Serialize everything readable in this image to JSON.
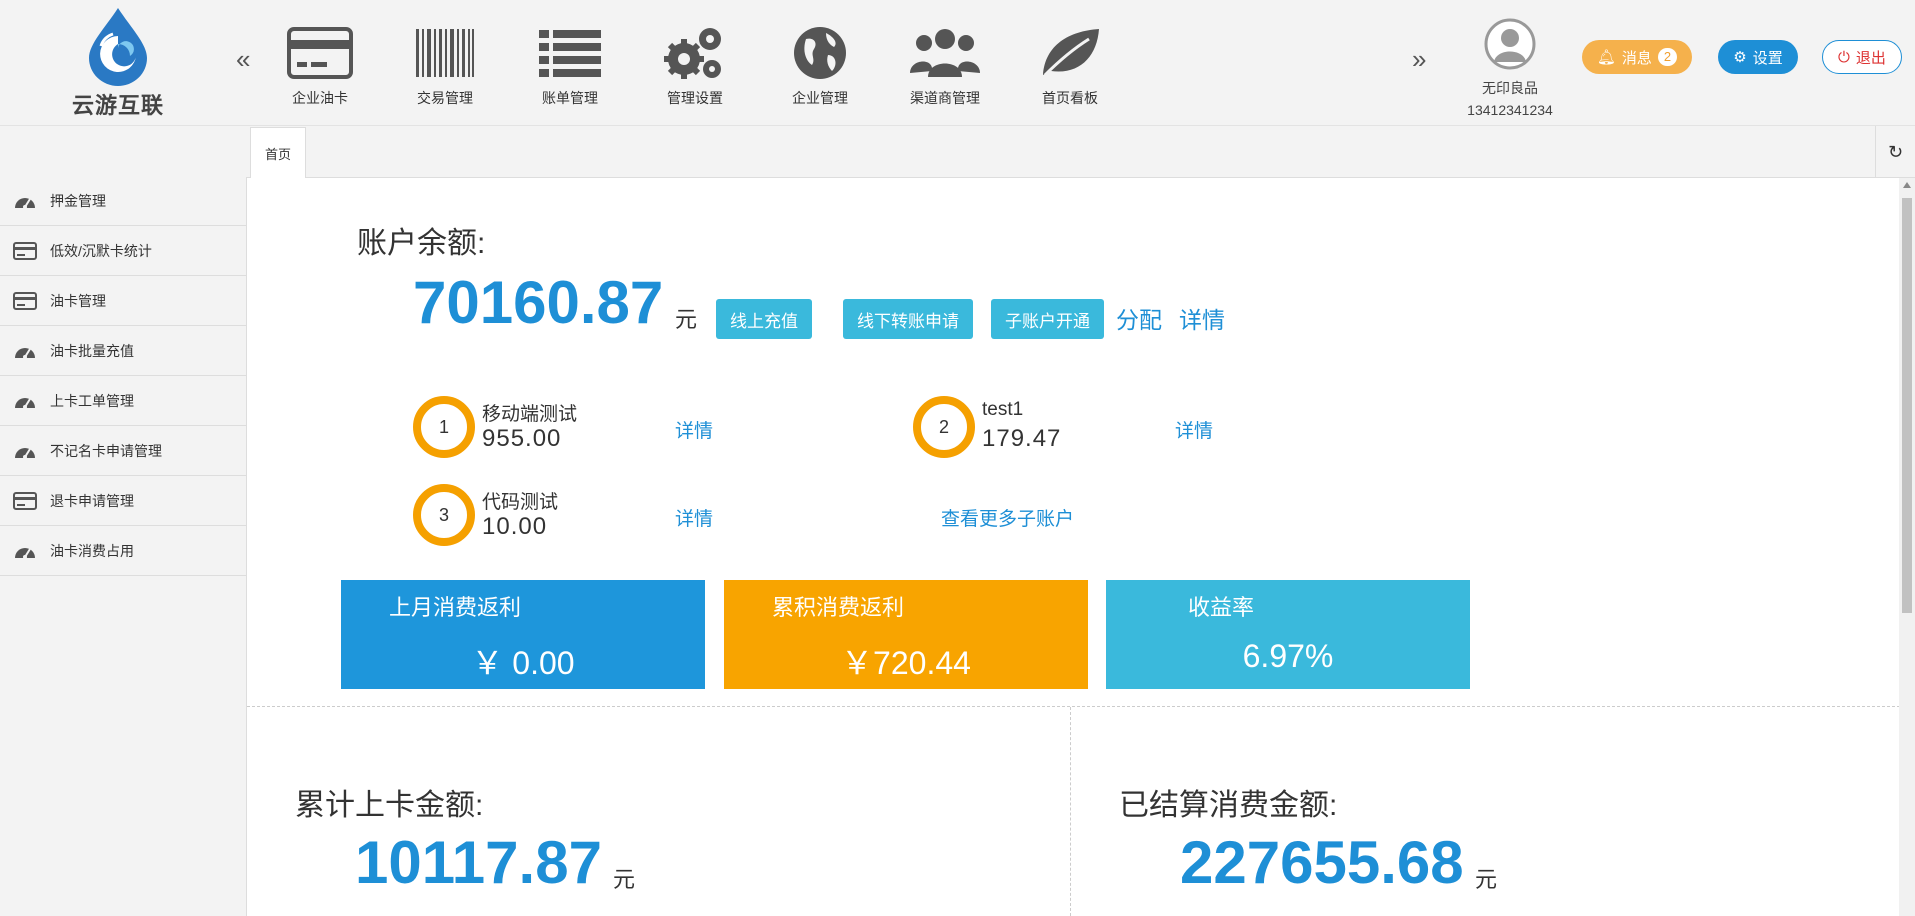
{
  "brand": {
    "name": "云游互联"
  },
  "nav": {
    "prev": "«",
    "next": "»",
    "items": [
      {
        "label": "企业油卡",
        "icon": "card-icon"
      },
      {
        "label": "交易管理",
        "icon": "barcode-icon"
      },
      {
        "label": "账单管理",
        "icon": "list-icon"
      },
      {
        "label": "管理设置",
        "icon": "gears-icon"
      },
      {
        "label": "企业管理",
        "icon": "globe-icon"
      },
      {
        "label": "渠道商管理",
        "icon": "users-icon"
      },
      {
        "label": "首页看板",
        "icon": "leaf-icon"
      }
    ]
  },
  "user": {
    "name": "无印良品",
    "phone": "13412341234"
  },
  "actions": {
    "messages": "消息",
    "messages_count": "2",
    "settings": "设置",
    "logout": "退出"
  },
  "tabs": {
    "home": "首页"
  },
  "sidebar": {
    "items": [
      {
        "label": "押金管理",
        "icon": "dashboard-icon"
      },
      {
        "label": "低效/沉默卡统计",
        "icon": "card-icon"
      },
      {
        "label": "油卡管理",
        "icon": "card-icon"
      },
      {
        "label": "油卡批量充值",
        "icon": "dashboard-icon"
      },
      {
        "label": "上卡工单管理",
        "icon": "dashboard-icon"
      },
      {
        "label": "不记名卡申请管理",
        "icon": "dashboard-icon"
      },
      {
        "label": "退卡申请管理",
        "icon": "card-icon"
      },
      {
        "label": "油卡消费占用",
        "icon": "dashboard-icon"
      }
    ]
  },
  "balance": {
    "label": "账户余额:",
    "amount": "70160.87",
    "unit": "元",
    "buttons": {
      "recharge": "线上充值",
      "transfer": "线下转账申请",
      "open_sub": "子账户开通"
    },
    "links": {
      "allocate": "分配",
      "details": "详情"
    }
  },
  "subaccounts": [
    {
      "rank": "1",
      "name": "移动端测试",
      "value": "955.00",
      "link": "详情"
    },
    {
      "rank": "2",
      "name": "test1",
      "value": "179.47",
      "link": "详情"
    },
    {
      "rank": "3",
      "name": "代码测试",
      "value": "10.00",
      "link": "详情"
    }
  ],
  "more_subaccounts": "查看更多子账户",
  "cards": [
    {
      "title": "上月消费返利",
      "value": "￥ 0.00",
      "color": "#1e96db"
    },
    {
      "title": "累积消费返利",
      "value": "￥720.44",
      "color": "#f8a400"
    },
    {
      "title": "收益率",
      "value": "6.97%",
      "color": "#3ab9dc"
    }
  ],
  "totals": {
    "loaded": {
      "label": "累计上卡金额:",
      "amount": "10117.87",
      "unit": "元"
    },
    "settled": {
      "label": "已结算消费金额:",
      "amount": "227655.68",
      "unit": "元"
    }
  }
}
